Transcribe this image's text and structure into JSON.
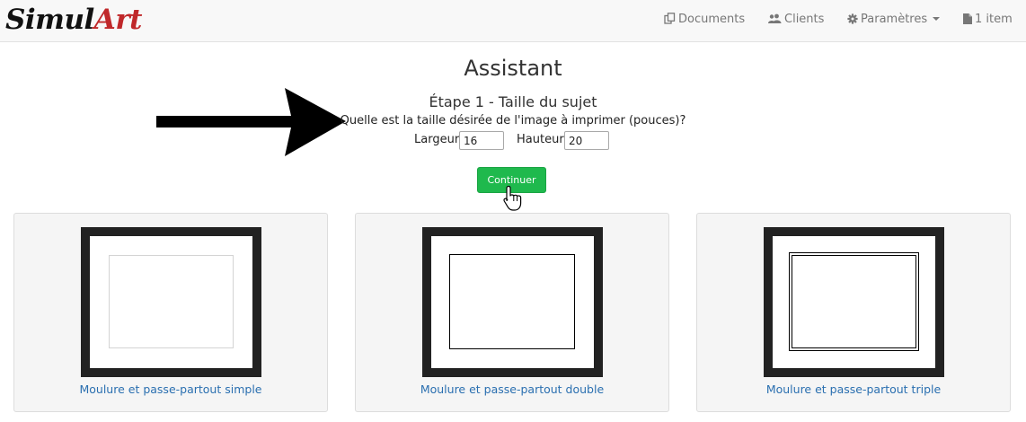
{
  "brand": {
    "part1": "Simul",
    "part2": "Art"
  },
  "nav": {
    "documents": "Documents",
    "clients": "Clients",
    "settings": "Paramètres",
    "cart": "1 item"
  },
  "wizard": {
    "title": "Assistant",
    "step": "Étape 1 - Taille du sujet",
    "question": "Quelle est la taille désirée de l'image à imprimer (pouces)?",
    "width_label": "Largeur",
    "width_value": "16",
    "height_label": "Hauteur",
    "height_value": "20",
    "continue_label": "Continuer"
  },
  "options": [
    {
      "label": "Moulure et passe-partout simple"
    },
    {
      "label": "Moulure et passe-partout double"
    },
    {
      "label": "Moulure et passe-partout triple"
    }
  ],
  "colors": {
    "continue_button": "#1fb94d",
    "link": "#2a6fb0",
    "brand_accent": "#c0282a"
  }
}
